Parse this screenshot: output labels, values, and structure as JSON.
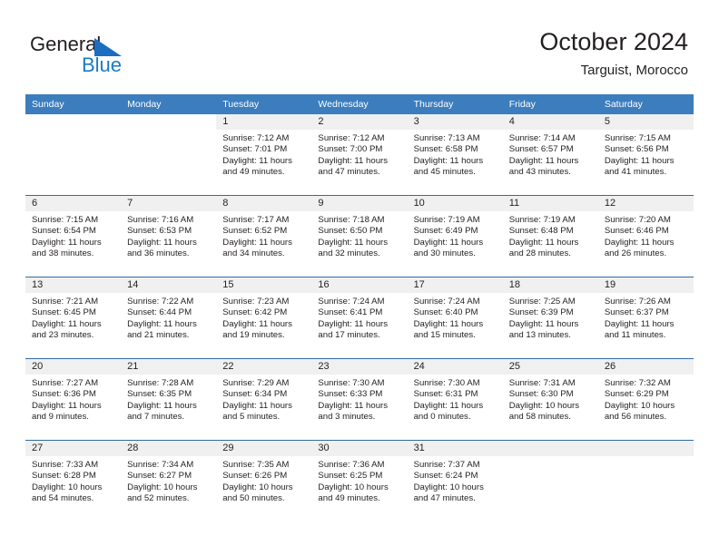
{
  "brand": {
    "name_top": "General",
    "name_bottom": "Blue",
    "accent_color": "#1b7bc0"
  },
  "header": {
    "title": "October 2024",
    "subtitle": "Targuist, Morocco"
  },
  "theme": {
    "header_row_bg": "#3b7dbd",
    "row_divider": "#2f6da4",
    "daynum_band_bg": "#f0f0f0",
    "text": "#231f20"
  },
  "weekdays": [
    "Sunday",
    "Monday",
    "Tuesday",
    "Wednesday",
    "Thursday",
    "Friday",
    "Saturday"
  ],
  "labels": {
    "sunrise_prefix": "Sunrise:",
    "sunset_prefix": "Sunset:",
    "daylight_prefix": "Daylight:"
  },
  "weeks": [
    [
      {
        "day": "",
        "sunrise": "",
        "sunset": "",
        "daylight_line1": "",
        "daylight_line2": "",
        "blank": true
      },
      {
        "day": "",
        "sunrise": "",
        "sunset": "",
        "daylight_line1": "",
        "daylight_line2": "",
        "blank": true
      },
      {
        "day": "1",
        "sunrise": "Sunrise: 7:12 AM",
        "sunset": "Sunset: 7:01 PM",
        "daylight_line1": "Daylight: 11 hours",
        "daylight_line2": "and 49 minutes."
      },
      {
        "day": "2",
        "sunrise": "Sunrise: 7:12 AM",
        "sunset": "Sunset: 7:00 PM",
        "daylight_line1": "Daylight: 11 hours",
        "daylight_line2": "and 47 minutes."
      },
      {
        "day": "3",
        "sunrise": "Sunrise: 7:13 AM",
        "sunset": "Sunset: 6:58 PM",
        "daylight_line1": "Daylight: 11 hours",
        "daylight_line2": "and 45 minutes."
      },
      {
        "day": "4",
        "sunrise": "Sunrise: 7:14 AM",
        "sunset": "Sunset: 6:57 PM",
        "daylight_line1": "Daylight: 11 hours",
        "daylight_line2": "and 43 minutes."
      },
      {
        "day": "5",
        "sunrise": "Sunrise: 7:15 AM",
        "sunset": "Sunset: 6:56 PM",
        "daylight_line1": "Daylight: 11 hours",
        "daylight_line2": "and 41 minutes."
      }
    ],
    [
      {
        "day": "6",
        "sunrise": "Sunrise: 7:15 AM",
        "sunset": "Sunset: 6:54 PM",
        "daylight_line1": "Daylight: 11 hours",
        "daylight_line2": "and 38 minutes."
      },
      {
        "day": "7",
        "sunrise": "Sunrise: 7:16 AM",
        "sunset": "Sunset: 6:53 PM",
        "daylight_line1": "Daylight: 11 hours",
        "daylight_line2": "and 36 minutes."
      },
      {
        "day": "8",
        "sunrise": "Sunrise: 7:17 AM",
        "sunset": "Sunset: 6:52 PM",
        "daylight_line1": "Daylight: 11 hours",
        "daylight_line2": "and 34 minutes."
      },
      {
        "day": "9",
        "sunrise": "Sunrise: 7:18 AM",
        "sunset": "Sunset: 6:50 PM",
        "daylight_line1": "Daylight: 11 hours",
        "daylight_line2": "and 32 minutes."
      },
      {
        "day": "10",
        "sunrise": "Sunrise: 7:19 AM",
        "sunset": "Sunset: 6:49 PM",
        "daylight_line1": "Daylight: 11 hours",
        "daylight_line2": "and 30 minutes."
      },
      {
        "day": "11",
        "sunrise": "Sunrise: 7:19 AM",
        "sunset": "Sunset: 6:48 PM",
        "daylight_line1": "Daylight: 11 hours",
        "daylight_line2": "and 28 minutes."
      },
      {
        "day": "12",
        "sunrise": "Sunrise: 7:20 AM",
        "sunset": "Sunset: 6:46 PM",
        "daylight_line1": "Daylight: 11 hours",
        "daylight_line2": "and 26 minutes."
      }
    ],
    [
      {
        "day": "13",
        "sunrise": "Sunrise: 7:21 AM",
        "sunset": "Sunset: 6:45 PM",
        "daylight_line1": "Daylight: 11 hours",
        "daylight_line2": "and 23 minutes."
      },
      {
        "day": "14",
        "sunrise": "Sunrise: 7:22 AM",
        "sunset": "Sunset: 6:44 PM",
        "daylight_line1": "Daylight: 11 hours",
        "daylight_line2": "and 21 minutes."
      },
      {
        "day": "15",
        "sunrise": "Sunrise: 7:23 AM",
        "sunset": "Sunset: 6:42 PM",
        "daylight_line1": "Daylight: 11 hours",
        "daylight_line2": "and 19 minutes."
      },
      {
        "day": "16",
        "sunrise": "Sunrise: 7:24 AM",
        "sunset": "Sunset: 6:41 PM",
        "daylight_line1": "Daylight: 11 hours",
        "daylight_line2": "and 17 minutes."
      },
      {
        "day": "17",
        "sunrise": "Sunrise: 7:24 AM",
        "sunset": "Sunset: 6:40 PM",
        "daylight_line1": "Daylight: 11 hours",
        "daylight_line2": "and 15 minutes."
      },
      {
        "day": "18",
        "sunrise": "Sunrise: 7:25 AM",
        "sunset": "Sunset: 6:39 PM",
        "daylight_line1": "Daylight: 11 hours",
        "daylight_line2": "and 13 minutes."
      },
      {
        "day": "19",
        "sunrise": "Sunrise: 7:26 AM",
        "sunset": "Sunset: 6:37 PM",
        "daylight_line1": "Daylight: 11 hours",
        "daylight_line2": "and 11 minutes."
      }
    ],
    [
      {
        "day": "20",
        "sunrise": "Sunrise: 7:27 AM",
        "sunset": "Sunset: 6:36 PM",
        "daylight_line1": "Daylight: 11 hours",
        "daylight_line2": "and 9 minutes."
      },
      {
        "day": "21",
        "sunrise": "Sunrise: 7:28 AM",
        "sunset": "Sunset: 6:35 PM",
        "daylight_line1": "Daylight: 11 hours",
        "daylight_line2": "and 7 minutes."
      },
      {
        "day": "22",
        "sunrise": "Sunrise: 7:29 AM",
        "sunset": "Sunset: 6:34 PM",
        "daylight_line1": "Daylight: 11 hours",
        "daylight_line2": "and 5 minutes."
      },
      {
        "day": "23",
        "sunrise": "Sunrise: 7:30 AM",
        "sunset": "Sunset: 6:33 PM",
        "daylight_line1": "Daylight: 11 hours",
        "daylight_line2": "and 3 minutes."
      },
      {
        "day": "24",
        "sunrise": "Sunrise: 7:30 AM",
        "sunset": "Sunset: 6:31 PM",
        "daylight_line1": "Daylight: 11 hours",
        "daylight_line2": "and 0 minutes."
      },
      {
        "day": "25",
        "sunrise": "Sunrise: 7:31 AM",
        "sunset": "Sunset: 6:30 PM",
        "daylight_line1": "Daylight: 10 hours",
        "daylight_line2": "and 58 minutes."
      },
      {
        "day": "26",
        "sunrise": "Sunrise: 7:32 AM",
        "sunset": "Sunset: 6:29 PM",
        "daylight_line1": "Daylight: 10 hours",
        "daylight_line2": "and 56 minutes."
      }
    ],
    [
      {
        "day": "27",
        "sunrise": "Sunrise: 7:33 AM",
        "sunset": "Sunset: 6:28 PM",
        "daylight_line1": "Daylight: 10 hours",
        "daylight_line2": "and 54 minutes."
      },
      {
        "day": "28",
        "sunrise": "Sunrise: 7:34 AM",
        "sunset": "Sunset: 6:27 PM",
        "daylight_line1": "Daylight: 10 hours",
        "daylight_line2": "and 52 minutes."
      },
      {
        "day": "29",
        "sunrise": "Sunrise: 7:35 AM",
        "sunset": "Sunset: 6:26 PM",
        "daylight_line1": "Daylight: 10 hours",
        "daylight_line2": "and 50 minutes."
      },
      {
        "day": "30",
        "sunrise": "Sunrise: 7:36 AM",
        "sunset": "Sunset: 6:25 PM",
        "daylight_line1": "Daylight: 10 hours",
        "daylight_line2": "and 49 minutes."
      },
      {
        "day": "31",
        "sunrise": "Sunrise: 7:37 AM",
        "sunset": "Sunset: 6:24 PM",
        "daylight_line1": "Daylight: 10 hours",
        "daylight_line2": "and 47 minutes."
      },
      {
        "day": "",
        "sunrise": "",
        "sunset": "",
        "daylight_line1": "",
        "daylight_line2": "",
        "trailing": true
      },
      {
        "day": "",
        "sunrise": "",
        "sunset": "",
        "daylight_line1": "",
        "daylight_line2": "",
        "trailing": true
      }
    ]
  ]
}
